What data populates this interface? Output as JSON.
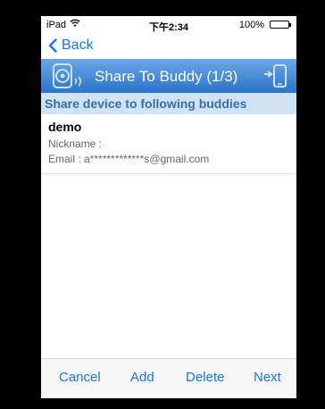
{
  "status_bar": {
    "device": "iPad",
    "time": "下午2:34",
    "battery": "100%"
  },
  "nav": {
    "back_label": "Back"
  },
  "title_bar": {
    "title": "Share To Buddy (1/3)"
  },
  "section": {
    "header": "Share device to following buddies"
  },
  "buddies": [
    {
      "name": "demo",
      "nickname": "Nickname :",
      "email": "Email : a*************s@gmail.com"
    }
  ],
  "toolbar": {
    "cancel": "Cancel",
    "add": "Add",
    "delete": "Delete",
    "next": "Next"
  },
  "colors": {
    "accent": "#1a73e8",
    "title_bar_top": "#6aa7e7",
    "title_bar_bottom": "#2c73c9",
    "section_bg": "#cfe3f3",
    "section_text": "#3a6ca8"
  },
  "icons": {
    "wifi": "wifi-icon",
    "battery": "battery-icon",
    "back": "chevron-left-icon",
    "title_left": "device-signal-icon",
    "title_right": "share-to-phone-icon"
  }
}
